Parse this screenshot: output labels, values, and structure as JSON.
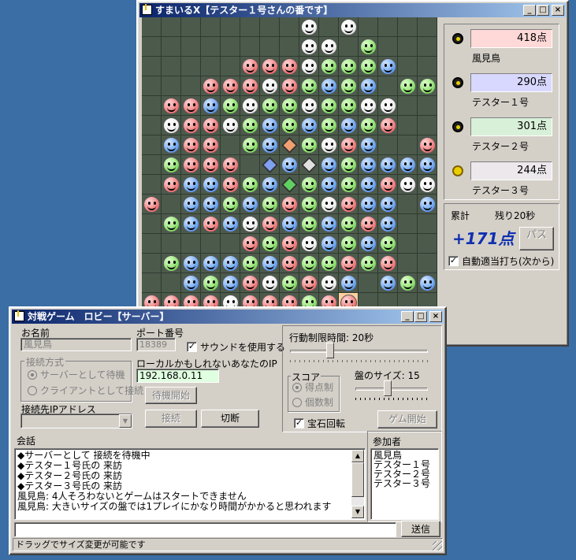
{
  "game_window": {
    "title": "すまいるX【テスター１号さんの番です】",
    "board": {
      "cols": 15,
      "rows": 15,
      "legend": {
        "r": "red-face",
        "g": "green-face",
        "b": "blue-face",
        "w": "white-face",
        "R": "red-gem",
        "B": "blue-gem",
        "W": "white-gem",
        "G": "green-gem",
        "S": "selected-red-face",
        ".": "empty"
      },
      "rows_data": [
        "........w.w....",
        "........ww.g...",
        ".....rrrwgggb..",
        "...rrrwrgbgb.gg",
        ".rrbgwggwggww..",
        ".wrrwgbgbgbgr..",
        ".brr.gbRgwrb..r",
        ".grrr.BbWbgbbbb",
        ".rbbrgbGgbgbrww",
        "r.bbgbgrgwrbb.b",
        ".gbrbwrbgbgrb..",
        ".....rgrwbgbg..",
        ".gbbbgbrggrgr..",
        "..bgbrwgrwb.bgb",
        "rrrrwrrrgrS....",
        "...........r..."
      ]
    },
    "players": [
      {
        "score": "418点",
        "name": "風見鳥",
        "color": "#ffd8d8",
        "turn": false
      },
      {
        "score": "290点",
        "name": "テスター１号",
        "color": "#d8d8ff",
        "turn": false
      },
      {
        "score": "301点",
        "name": "テスター２号",
        "color": "#d8f0d8",
        "turn": false
      },
      {
        "score": "244点",
        "name": "テスター３号",
        "color": "#ece8ec",
        "turn": true
      }
    ],
    "total_label": "累計",
    "remain": "残り20秒",
    "big_score": "+171点",
    "pass_label": "パス",
    "auto_label": "自動適当打ち(次から)",
    "auto_checked": "✓"
  },
  "lobby": {
    "title": "対戦ゲーム　ロビー【サーバー】",
    "name_label": "お名前",
    "name_value": "風見鳥",
    "port_label": "ポート番号",
    "port_value": "18389",
    "sound_label": "サウンドを使用する",
    "sound_checked": "✓",
    "conn_group_label": "接続方式",
    "server_radio": "サーバーとして待機",
    "client_radio": "クライアントとして接続",
    "local_ip_label": "ローカルかもしれないあなたのIP",
    "local_ip_value": "192.168.0.11",
    "wait_start_label": "待機開始",
    "dest_ip_label": "接続先IPアドレス",
    "connect_label": "接続",
    "disconnect_label": "切断",
    "time_limit_label": "行動制限時間: 20秒",
    "score_group_label": "スコア",
    "score_radio1": "得点制",
    "score_radio2": "個数制",
    "board_size_label": "盤のサイズ: 15",
    "gem_rotate_label": "宝石回転",
    "gem_checked": "✓",
    "game_start_label": "ゲム開始",
    "chat_label": "会話",
    "chat_lines": [
      "◆サーバーとして 接続を待機中",
      "◆テスター１号氏の 来訪",
      "◆テスター２号氏の 来訪",
      "◆テスター３号氏の 来訪",
      "風見鳥: 4人そろわないとゲームはスタートできません",
      "風見鳥: 大きいサイズの盤では1プレイにかなり時間がかかると思われます"
    ],
    "members_label": "参加者",
    "members": [
      "風見鳥",
      "テスター１号",
      "テスター２号",
      "テスター３号"
    ],
    "send_label": "送信",
    "status": "ドラッグでサイズ変更が可能です"
  }
}
